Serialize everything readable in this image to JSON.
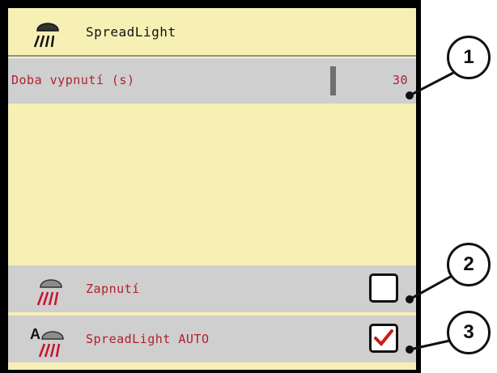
{
  "header": {
    "title": "SpreadLight",
    "icon": "spreadlight-icon"
  },
  "time_row": {
    "label": "Doba vypnutí (s)",
    "value": "30"
  },
  "on_row": {
    "label": "Zapnutí",
    "icon": "spreadlight-icon",
    "checked": false
  },
  "auto_row": {
    "label": "SpreadLight AUTO",
    "icon": "spreadlight-auto-icon",
    "checked": true
  },
  "callouts": [
    "1",
    "2",
    "3"
  ],
  "colors": {
    "panel": "#f7f0b5",
    "row": "#cfcfcf",
    "text_red": "#b2202b",
    "check_red": "#cc1b1b"
  }
}
